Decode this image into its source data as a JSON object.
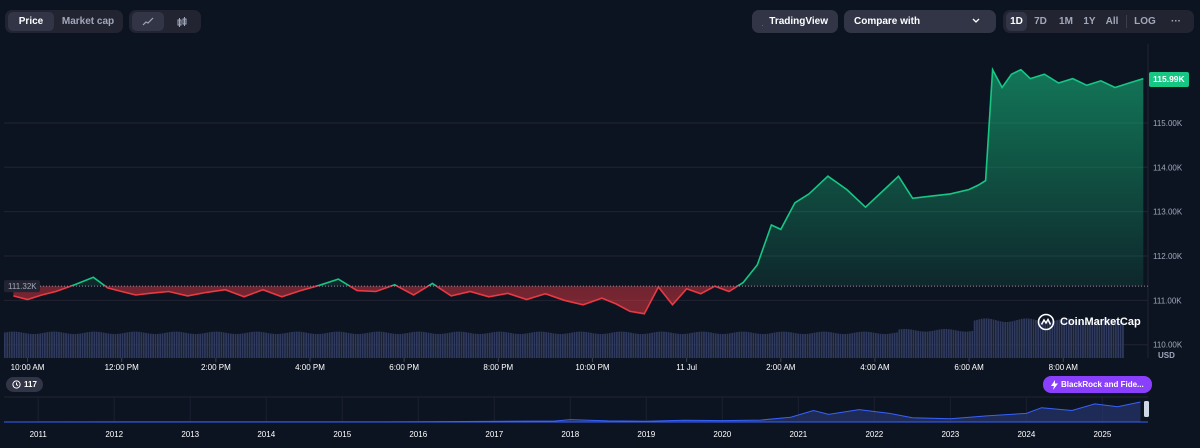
{
  "toolbar": {
    "tabs": [
      {
        "label": "Price",
        "active": true
      },
      {
        "label": "Market cap",
        "active": false
      }
    ],
    "chart_styles": [
      "line-chart-icon",
      "candlestick-icon"
    ],
    "tradingview_label": "TradingView",
    "compare_placeholder": "Compare with",
    "ranges": [
      "1D",
      "7D",
      "1M",
      "1Y",
      "All",
      "LOG"
    ],
    "active_range": "1D",
    "more_label": "···"
  },
  "colors": {
    "up": "#16c784",
    "down": "#ea3943",
    "background": "#0d1421",
    "volume": "#2f3a5e",
    "price_tag": "#16c784"
  },
  "chart_data": {
    "type": "line",
    "reference_price": 111.32,
    "reference_label": "111.32K",
    "current_price": 115.99,
    "current_label": "115.99K",
    "y_unit": "USD",
    "ylim": [
      109.7,
      116.6
    ],
    "yticks": [
      "110.00K",
      "111.00K",
      "112.00K",
      "113.00K",
      "114.00K",
      "115.00K"
    ],
    "ytick_values": [
      110,
      111,
      112,
      113,
      114,
      115
    ],
    "xlim_hours": [
      9.5,
      33.8
    ],
    "xticks": [
      {
        "label": "10:00 AM",
        "h": 10
      },
      {
        "label": "12:00 PM",
        "h": 12
      },
      {
        "label": "2:00 PM",
        "h": 14
      },
      {
        "label": "4:00 PM",
        "h": 16
      },
      {
        "label": "6:00 PM",
        "h": 18
      },
      {
        "label": "8:00 PM",
        "h": 20
      },
      {
        "label": "10:00 PM",
        "h": 22
      },
      {
        "label": "11 Jul",
        "h": 24
      },
      {
        "label": "2:00 AM",
        "h": 26
      },
      {
        "label": "4:00 AM",
        "h": 28
      },
      {
        "label": "6:00 AM",
        "h": 30
      },
      {
        "label": "8:00 AM",
        "h": 32
      }
    ],
    "series": [
      {
        "x": [
          9.7,
          10.0,
          10.3,
          10.6,
          11.0,
          11.4,
          11.7,
          12.0,
          12.3,
          12.6,
          13.0,
          13.4,
          13.8,
          14.2,
          14.6,
          15.0,
          15.4,
          15.8,
          16.2,
          16.6,
          17.0,
          17.4,
          17.8,
          18.2,
          18.6,
          19.0,
          19.4,
          19.8,
          20.2,
          20.6,
          21.0,
          21.4,
          21.8,
          22.2,
          22.5,
          22.8,
          23.1,
          23.4,
          23.7,
          24.0,
          24.3,
          24.6,
          24.9,
          25.2,
          25.5,
          25.8,
          26.0,
          26.3,
          26.6,
          27.0,
          27.4,
          27.8,
          28.2,
          28.5,
          28.8,
          29.2,
          29.6,
          30.0,
          30.2,
          30.35,
          30.5,
          30.7,
          30.9,
          31.1,
          31.3,
          31.6,
          31.9,
          32.2,
          32.5,
          32.8,
          33.1,
          33.4,
          33.7
        ],
        "y": [
          111.1,
          111.02,
          111.12,
          111.2,
          111.35,
          111.52,
          111.28,
          111.2,
          111.12,
          111.16,
          111.2,
          111.1,
          111.18,
          111.24,
          111.08,
          111.24,
          111.08,
          111.22,
          111.34,
          111.48,
          111.22,
          111.2,
          111.35,
          111.12,
          111.38,
          111.1,
          111.2,
          111.08,
          111.16,
          111.02,
          111.15,
          111.0,
          110.9,
          111.05,
          110.92,
          110.75,
          110.7,
          111.3,
          110.9,
          111.26,
          111.15,
          111.32,
          111.2,
          111.4,
          111.8,
          112.7,
          112.6,
          113.2,
          113.4,
          113.8,
          113.5,
          113.1,
          113.5,
          113.8,
          113.3,
          113.35,
          113.4,
          113.5,
          113.6,
          113.7,
          116.2,
          115.8,
          116.1,
          116.2,
          116.0,
          116.1,
          115.9,
          116.0,
          115.85,
          115.95,
          115.8,
          115.9,
          116.0
        ]
      }
    ],
    "volume_label": "USD",
    "navigator": {
      "years": [
        "2011",
        "2012",
        "2013",
        "2014",
        "2015",
        "2016",
        "2017",
        "2018",
        "2019",
        "2020",
        "2021",
        "2022",
        "2023",
        "2024",
        "2025"
      ],
      "year_start": 2010.55,
      "year_end": 2025.6,
      "series": [
        [
          2010.6,
          0.0
        ],
        [
          2013.0,
          0.01
        ],
        [
          2016.0,
          0.02
        ],
        [
          2017.8,
          0.1
        ],
        [
          2018.0,
          0.25
        ],
        [
          2018.5,
          0.12
        ],
        [
          2019.0,
          0.08
        ],
        [
          2019.5,
          0.18
        ],
        [
          2020.0,
          0.15
        ],
        [
          2020.5,
          0.2
        ],
        [
          2020.9,
          0.5
        ],
        [
          2021.2,
          1.2
        ],
        [
          2021.4,
          0.8
        ],
        [
          2021.8,
          1.3
        ],
        [
          2022.2,
          0.9
        ],
        [
          2022.5,
          0.45
        ],
        [
          2023.0,
          0.35
        ],
        [
          2023.5,
          0.65
        ],
        [
          2024.0,
          0.9
        ],
        [
          2024.2,
          1.5
        ],
        [
          2024.6,
          1.2
        ],
        [
          2024.9,
          1.9
        ],
        [
          2025.2,
          1.6
        ],
        [
          2025.5,
          2.1
        ]
      ]
    }
  },
  "markers": {
    "event_count": "117",
    "news_title": "BlackRock and Fide..."
  },
  "watermark": "CoinMarketCap"
}
